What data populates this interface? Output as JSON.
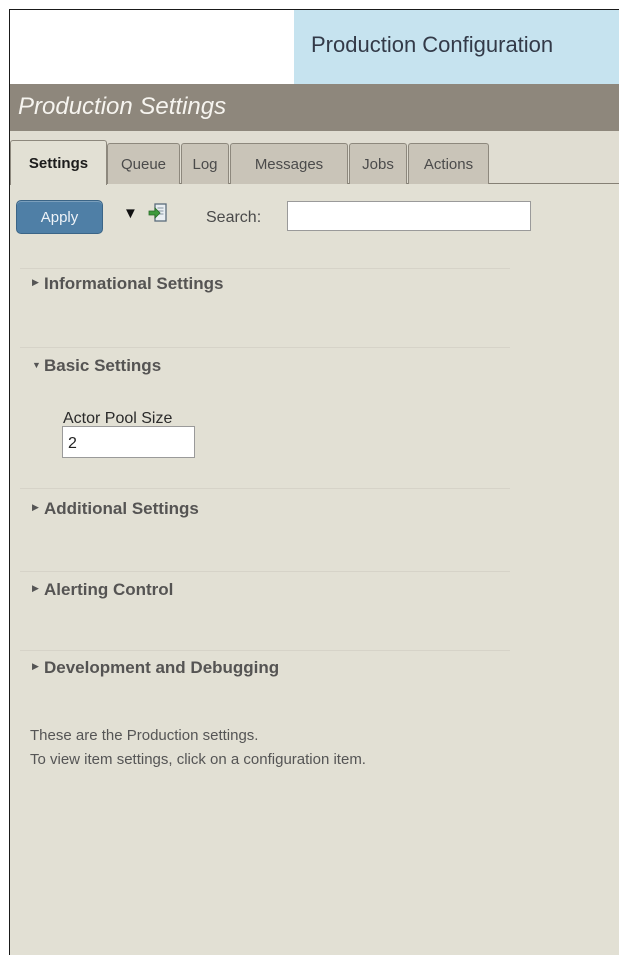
{
  "header": {
    "title": "Production Configuration"
  },
  "panel": {
    "title": "Production Settings"
  },
  "tabs": [
    {
      "label": "Settings",
      "active": true
    },
    {
      "label": "Queue",
      "active": false
    },
    {
      "label": "Log",
      "active": false
    },
    {
      "label": "Messages",
      "active": false
    },
    {
      "label": "Jobs",
      "active": false
    },
    {
      "label": "Actions",
      "active": false
    }
  ],
  "toolbar": {
    "apply_label": "Apply",
    "dropdown_icon": "triangle-down-icon",
    "export_icon": "export-icon",
    "search_label": "Search:",
    "search_value": ""
  },
  "sections": [
    {
      "label": "Informational Settings",
      "expanded": false
    },
    {
      "label": "Basic Settings",
      "expanded": true
    },
    {
      "label": "Additional Settings",
      "expanded": false
    },
    {
      "label": "Alerting Control",
      "expanded": false
    },
    {
      "label": "Development and Debugging",
      "expanded": false
    }
  ],
  "basic_settings": {
    "actor_pool_size_label": "Actor Pool Size",
    "actor_pool_size_value": "2"
  },
  "footer_info": {
    "line1": "These are the Production settings.",
    "line2": "To view item settings, click on a configuration item."
  },
  "colors": {
    "header_accent": "#c6e3ef",
    "title_bar": "#8e877c",
    "panel_bg": "#e2e0d4",
    "apply_button": "#4f7fa6"
  }
}
